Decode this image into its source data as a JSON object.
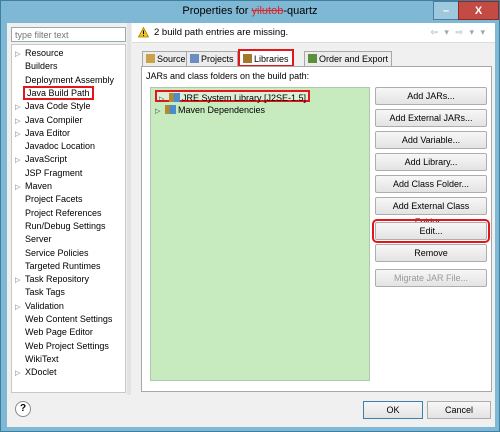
{
  "window": {
    "title_prefix": "Properties for ",
    "title_redacted": "yilutob",
    "title_suffix": "-quartz",
    "minimize": "–",
    "close": "X"
  },
  "filter": {
    "placeholder": "type filter text"
  },
  "nav": {
    "items": [
      {
        "label": "Resource",
        "arrow": true
      },
      {
        "label": "Builders",
        "arrow": false
      },
      {
        "label": "Deployment Assembly",
        "arrow": false
      },
      {
        "label": "Java Build Path",
        "arrow": false,
        "selected": true
      },
      {
        "label": "Java Code Style",
        "arrow": true
      },
      {
        "label": "Java Compiler",
        "arrow": true
      },
      {
        "label": "Java Editor",
        "arrow": true
      },
      {
        "label": "Javadoc Location",
        "arrow": false
      },
      {
        "label": "JavaScript",
        "arrow": true
      },
      {
        "label": "JSP Fragment",
        "arrow": false
      },
      {
        "label": "Maven",
        "arrow": true
      },
      {
        "label": "Project Facets",
        "arrow": false
      },
      {
        "label": "Project References",
        "arrow": false
      },
      {
        "label": "Run/Debug Settings",
        "arrow": false
      },
      {
        "label": "Server",
        "arrow": false
      },
      {
        "label": "Service Policies",
        "arrow": false
      },
      {
        "label": "Targeted Runtimes",
        "arrow": false
      },
      {
        "label": "Task Repository",
        "arrow": true
      },
      {
        "label": "Task Tags",
        "arrow": false
      },
      {
        "label": "Validation",
        "arrow": true
      },
      {
        "label": "Web Content Settings",
        "arrow": false
      },
      {
        "label": "Web Page Editor",
        "arrow": false
      },
      {
        "label": "Web Project Settings",
        "arrow": false
      },
      {
        "label": "WikiText",
        "arrow": false
      },
      {
        "label": "XDoclet",
        "arrow": true
      }
    ]
  },
  "header": {
    "message": "2 build path entries are missing.",
    "nav_arrows": "⇦ ▾ ⇨ ▾ ▾"
  },
  "tabs": [
    {
      "label": "Source",
      "icon": "source-folder-icon"
    },
    {
      "label": "Projects",
      "icon": "projects-icon"
    },
    {
      "label": "Libraries",
      "icon": "libraries-icon",
      "active": true
    },
    {
      "label": "Order and Export",
      "icon": "order-export-icon"
    }
  ],
  "libraries": {
    "panel_label": "JARs and class folders on the build path:",
    "entries": [
      {
        "label": "JRE System Library [J2SE-1.5]",
        "selected": true
      },
      {
        "label": "Maven Dependencies",
        "selected": false
      }
    ]
  },
  "buttons": [
    {
      "label": "Add JARs...",
      "enabled": true
    },
    {
      "label": "Add External JARs...",
      "enabled": true
    },
    {
      "label": "Add Variable...",
      "enabled": true
    },
    {
      "label": "Add Library...",
      "enabled": true
    },
    {
      "label": "Add Class Folder...",
      "enabled": true
    },
    {
      "label": "Add External Class Folder...",
      "enabled": true
    },
    {
      "label": "Edit...",
      "enabled": true,
      "highlighted": true
    },
    {
      "label": "Remove",
      "enabled": true
    },
    {
      "label": "Migrate JAR File...",
      "enabled": false
    }
  ],
  "footer": {
    "help": "?",
    "ok": "OK",
    "cancel": "Cancel"
  },
  "colors": {
    "highlight_red": "#e3161a",
    "library_bg": "#c7ebbf",
    "titlebar": "#7fb8d4"
  }
}
